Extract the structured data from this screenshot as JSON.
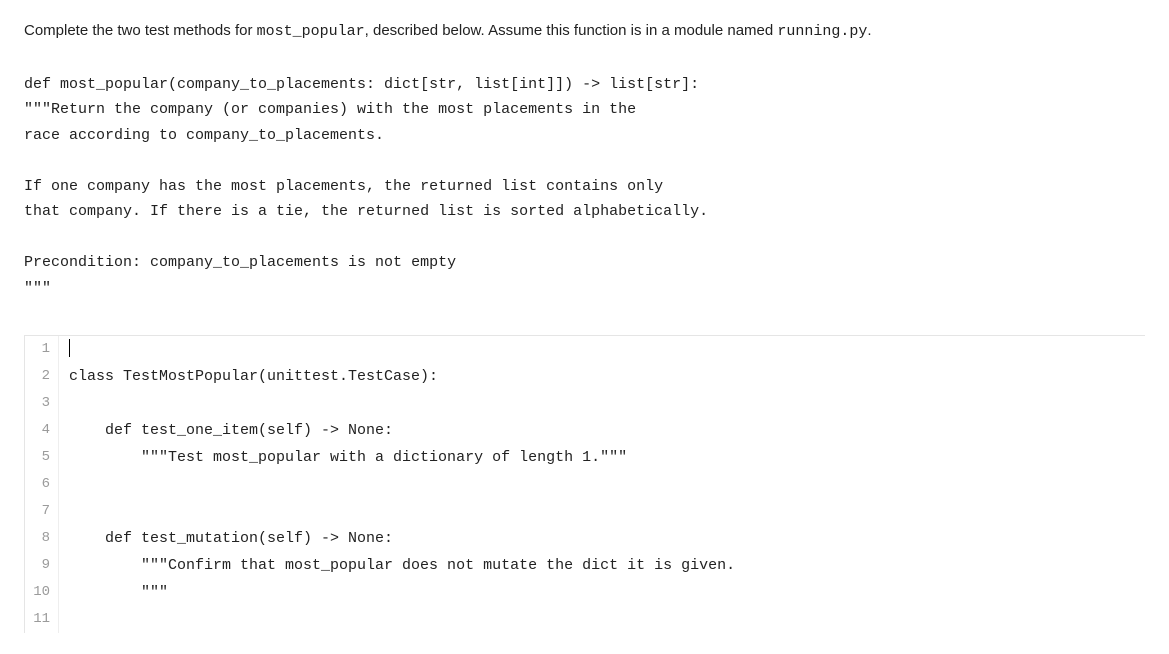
{
  "intro": {
    "prefix": "Complete the two test methods for ",
    "funcName": "most_popular",
    "middle": ", described below. Assume this function is in a module named ",
    "moduleName": "running.py",
    "suffix": "."
  },
  "docstring": "def most_popular(company_to_placements: dict[str, list[int]]) -> list[str]:\n\"\"\"Return the company (or companies) with the most placements in the\nrace according to company_to_placements.\n\nIf one company has the most placements, the returned list contains only\nthat company. If there is a tie, the returned list is sorted alphabetically.\n\nPrecondition: company_to_placements is not empty\n\"\"\"",
  "editor": {
    "lines": [
      {
        "n": "1",
        "code": ""
      },
      {
        "n": "2",
        "code": "class TestMostPopular(unittest.TestCase):"
      },
      {
        "n": "3",
        "code": ""
      },
      {
        "n": "4",
        "code": "    def test_one_item(self) -> None:"
      },
      {
        "n": "5",
        "code": "        \"\"\"Test most_popular with a dictionary of length 1.\"\"\""
      },
      {
        "n": "6",
        "code": ""
      },
      {
        "n": "7",
        "code": ""
      },
      {
        "n": "8",
        "code": "    def test_mutation(self) -> None:"
      },
      {
        "n": "9",
        "code": "        \"\"\"Confirm that most_popular does not mutate the dict it is given."
      },
      {
        "n": "10",
        "code": "        \"\"\""
      },
      {
        "n": "11",
        "code": ""
      }
    ]
  }
}
